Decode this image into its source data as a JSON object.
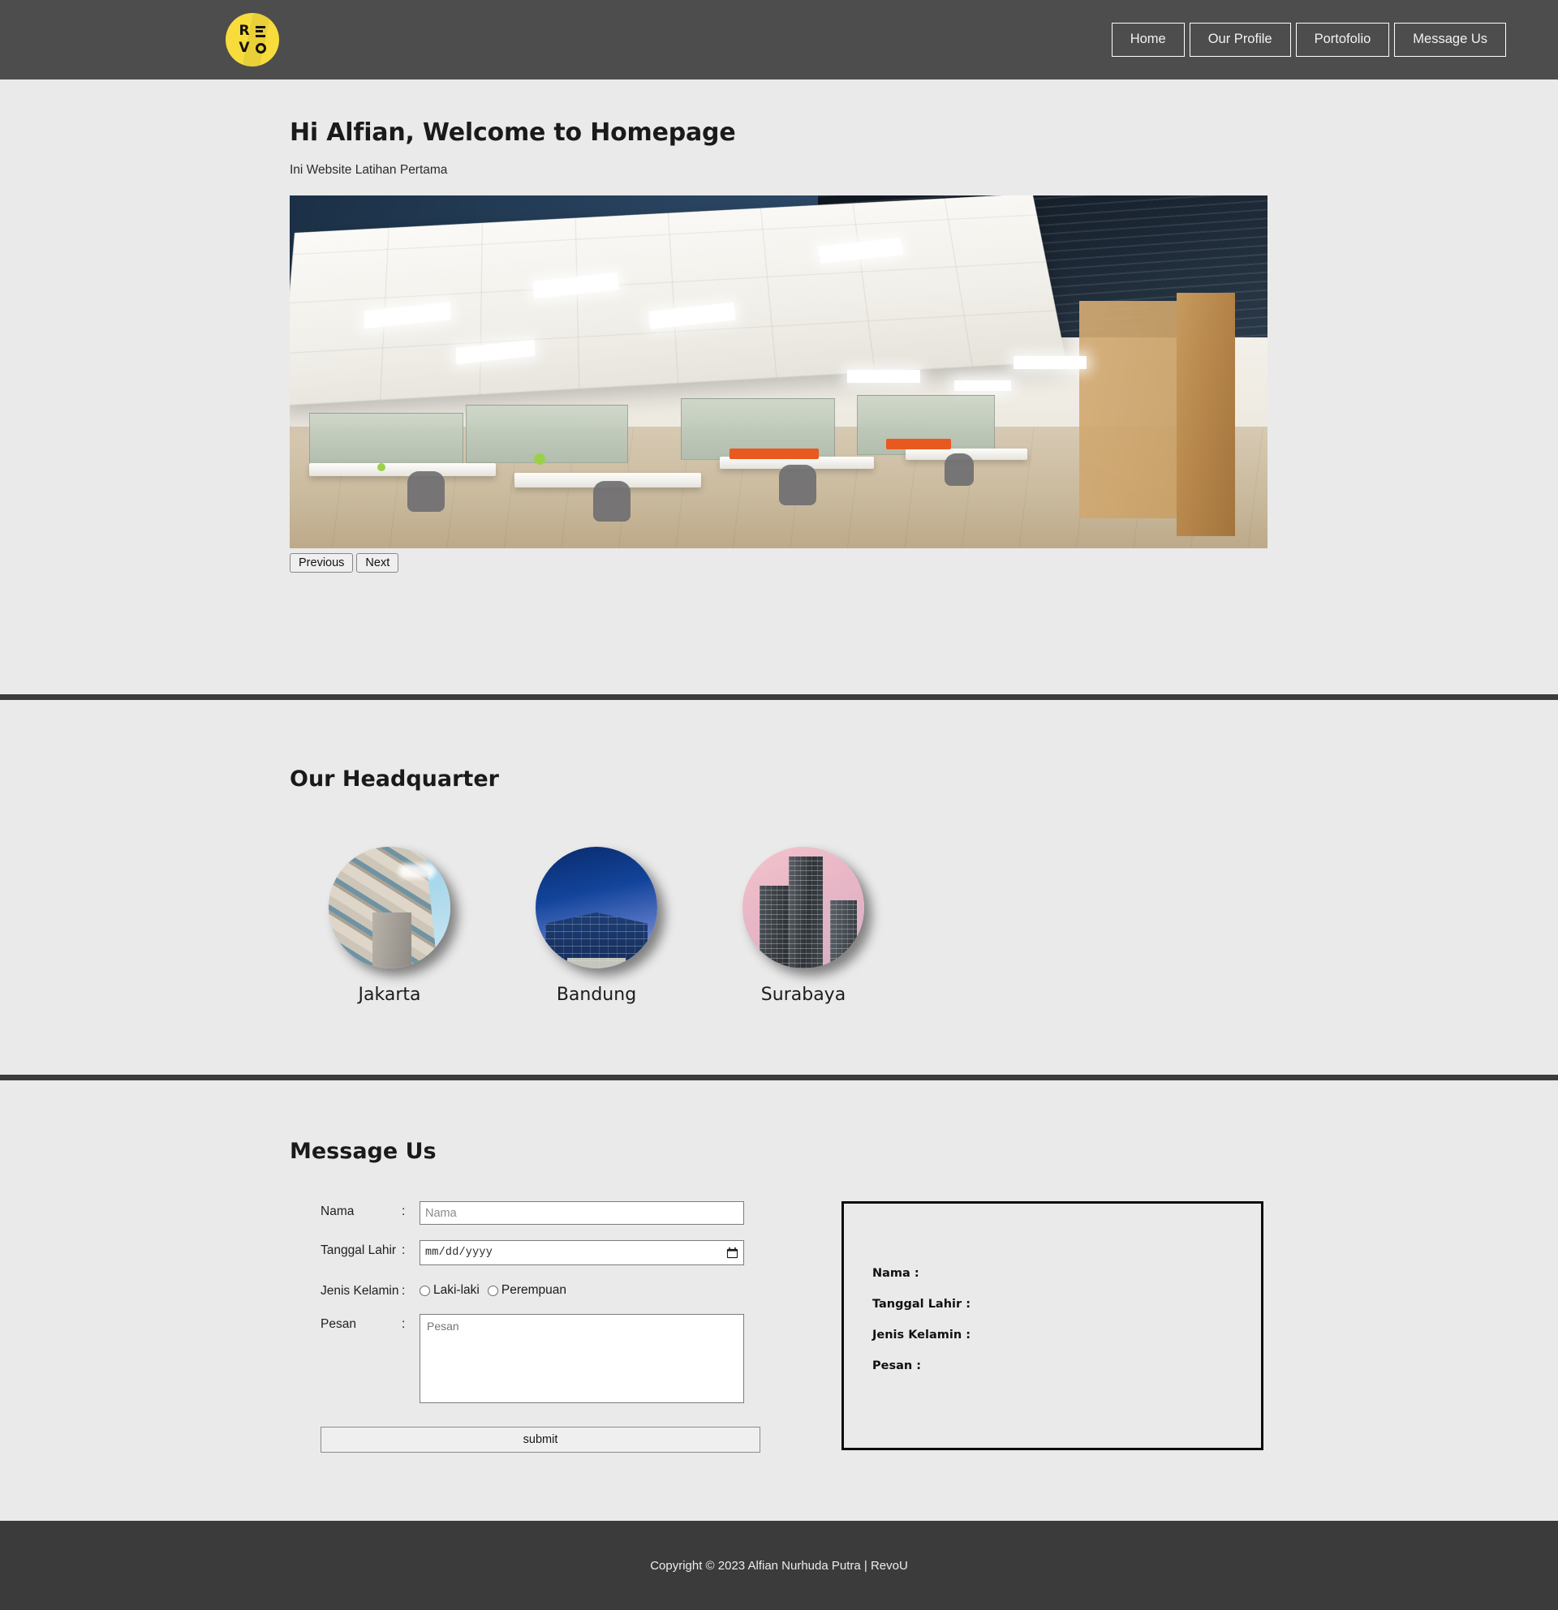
{
  "header": {
    "logo": {
      "name": "revo-logo",
      "text": "REVO",
      "color": "#f7dc3c"
    },
    "nav": [
      {
        "label": "Home",
        "name": "nav-home"
      },
      {
        "label": "Our Profile",
        "name": "nav-our-profile"
      },
      {
        "label": "Portofolio",
        "name": "nav-portofolio"
      },
      {
        "label": "Message Us",
        "name": "nav-message-us"
      }
    ]
  },
  "hero": {
    "title": "Hi Alfian, Welcome to Homepage",
    "subtitle": "Ini Website Latihan Pertama",
    "carousel": {
      "prev_label": "Previous",
      "next_label": "Next",
      "image_alt": "office-interior-photo"
    }
  },
  "headquarter": {
    "title": "Our Headquarter",
    "cities": [
      {
        "label": "Jakarta",
        "name": "hq-jakarta"
      },
      {
        "label": "Bandung",
        "name": "hq-bandung"
      },
      {
        "label": "Surabaya",
        "name": "hq-surabaya"
      }
    ]
  },
  "message": {
    "title": "Message Us",
    "fields": {
      "nama_label": "Nama",
      "nama_placeholder": "Nama",
      "tanggal_label": "Tanggal Lahir",
      "tanggal_placeholder": "mm/dd/yyyy",
      "jenis_label": "Jenis Kelamin",
      "gender_options": [
        "Laki-laki",
        "Perempuan"
      ],
      "pesan_label": "Pesan",
      "pesan_placeholder": "Pesan",
      "colon": ":"
    },
    "submit_label": "submit",
    "result": {
      "nama": "Nama :",
      "tanggal": "Tanggal Lahir :",
      "jenis": "Jenis Kelamin :",
      "pesan": "Pesan :"
    }
  },
  "footer": {
    "copyright": "Copyright © 2023 Alfian Nurhuda Putra | RevoU"
  },
  "colors": {
    "header_bg": "#4d4d4d",
    "page_bg": "#eaeaea",
    "divider": "#3b3b3b",
    "footer_bg": "#3b3b3b",
    "brand_yellow": "#f7dc3c"
  }
}
